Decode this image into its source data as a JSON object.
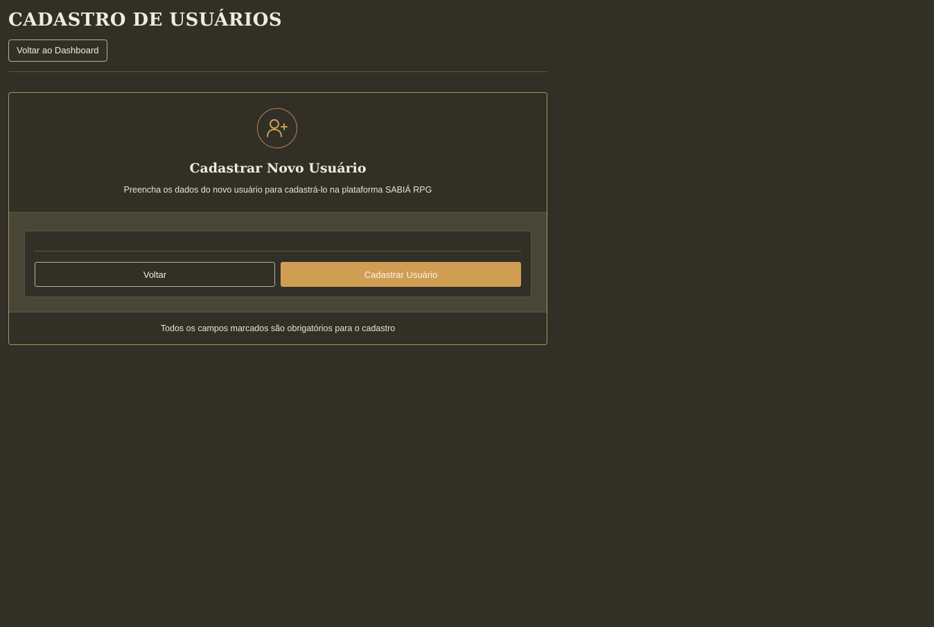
{
  "header": {
    "title": "CADASTRO DE USUÁRIOS",
    "back_dashboard_label": "Voltar ao Dashboard"
  },
  "card": {
    "icon": "user-plus-icon",
    "title": "Cadastrar Novo Usuário",
    "subtitle": "Preencha os dados do novo usuário para cadastrá-lo na plataforma SABIÁ RPG",
    "back_label": "Voltar",
    "submit_label": "Cadastrar Usuário",
    "footer_note": "Todos os campos marcados são obrigatórios para o cadastro"
  },
  "colors": {
    "background": "#312f26",
    "accent": "#cf9e52",
    "panel": "#4a4637",
    "text": "#f1ebdc"
  }
}
